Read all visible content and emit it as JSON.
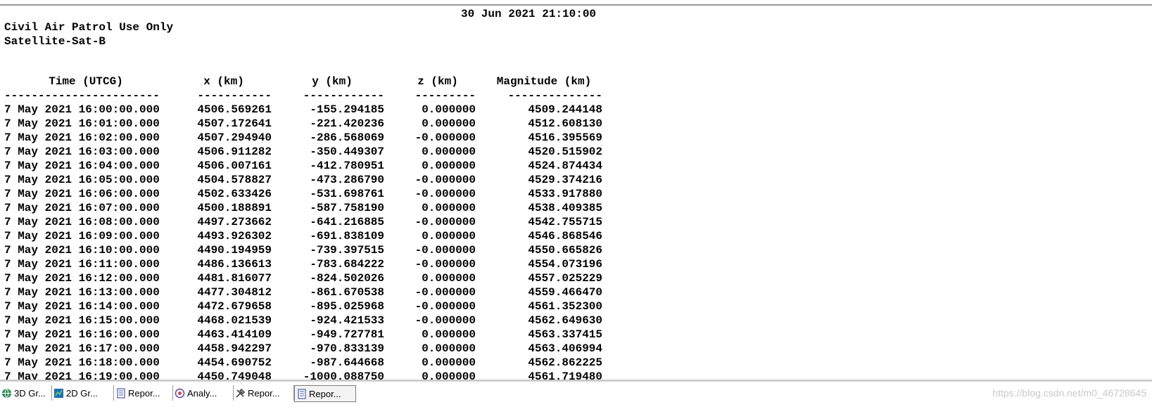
{
  "report": {
    "date": "30 Jun 2021 21:10:00",
    "line1": "Civil Air Patrol Use Only",
    "line2": "Satellite-Sat-B",
    "columns": [
      "Time (UTCG)",
      "x (km)",
      "y (km)",
      "z (km)",
      "Magnitude (km)"
    ],
    "dashes": [
      "-----------------------",
      "-----------",
      "------------",
      "---------",
      "--------------"
    ],
    "rows": [
      [
        "7 May 2021 16:00:00.000",
        "4506.569261",
        "-155.294185",
        "0.000000",
        "4509.244148"
      ],
      [
        "7 May 2021 16:01:00.000",
        "4507.172641",
        "-221.420236",
        "0.000000",
        "4512.608130"
      ],
      [
        "7 May 2021 16:02:00.000",
        "4507.294940",
        "-286.568069",
        "-0.000000",
        "4516.395569"
      ],
      [
        "7 May 2021 16:03:00.000",
        "4506.911282",
        "-350.449307",
        "0.000000",
        "4520.515902"
      ],
      [
        "7 May 2021 16:04:00.000",
        "4506.007161",
        "-412.780951",
        "0.000000",
        "4524.874434"
      ],
      [
        "7 May 2021 16:05:00.000",
        "4504.578827",
        "-473.286790",
        "-0.000000",
        "4529.374216"
      ],
      [
        "7 May 2021 16:06:00.000",
        "4502.633426",
        "-531.698761",
        "-0.000000",
        "4533.917880"
      ],
      [
        "7 May 2021 16:07:00.000",
        "4500.188891",
        "-587.758190",
        "0.000000",
        "4538.409385"
      ],
      [
        "7 May 2021 16:08:00.000",
        "4497.273662",
        "-641.216885",
        "-0.000000",
        "4542.755715"
      ],
      [
        "7 May 2021 16:09:00.000",
        "4493.926302",
        "-691.838109",
        "0.000000",
        "4546.868546"
      ],
      [
        "7 May 2021 16:10:00.000",
        "4490.194959",
        "-739.397515",
        "-0.000000",
        "4550.665826"
      ],
      [
        "7 May 2021 16:11:00.000",
        "4486.136613",
        "-783.684222",
        "-0.000000",
        "4554.073196"
      ],
      [
        "7 May 2021 16:12:00.000",
        "4481.816077",
        "-824.502026",
        "0.000000",
        "4557.025229"
      ],
      [
        "7 May 2021 16:13:00.000",
        "4477.304812",
        "-861.670538",
        "-0.000000",
        "4559.466470"
      ],
      [
        "7 May 2021 16:14:00.000",
        "4472.679658",
        "-895.025968",
        "-0.000000",
        "4561.352300"
      ],
      [
        "7 May 2021 16:15:00.000",
        "4468.021539",
        "-924.421533",
        "-0.000000",
        "4562.649630"
      ],
      [
        "7 May 2021 16:16:00.000",
        "4463.414109",
        "-949.727781",
        "0.000000",
        "4563.337415"
      ],
      [
        "7 May 2021 16:17:00.000",
        "4458.942297",
        "-970.833139",
        "0.000000",
        "4563.406994"
      ],
      [
        "7 May 2021 16:18:00.000",
        "4454.690752",
        "-987.644668",
        "0.000000",
        "4562.862225"
      ],
      [
        "7 May 2021 16:19:00.000",
        "4450.749048",
        "-1000.088750",
        "0.000000",
        "4561.719480"
      ]
    ]
  },
  "taskbar": {
    "tabs": [
      {
        "label": "3D Gr...",
        "icon": "globe-icon",
        "color": "#2e8b57"
      },
      {
        "label": "2D Gr...",
        "icon": "map-icon",
        "color": "#1f6fb2"
      },
      {
        "label": "Repor...",
        "icon": "report-icon",
        "color": "#4a5aa8"
      },
      {
        "label": "Analy...",
        "icon": "analysis-icon",
        "color": "#6a3fa0"
      },
      {
        "label": "Repor...",
        "icon": "tools-icon",
        "color": "#444444"
      },
      {
        "label": "Repor...",
        "icon": "report-icon",
        "color": "#4a5aa8",
        "active": true
      }
    ]
  },
  "watermark": "https://blog.csdn.net/m0_46728645"
}
